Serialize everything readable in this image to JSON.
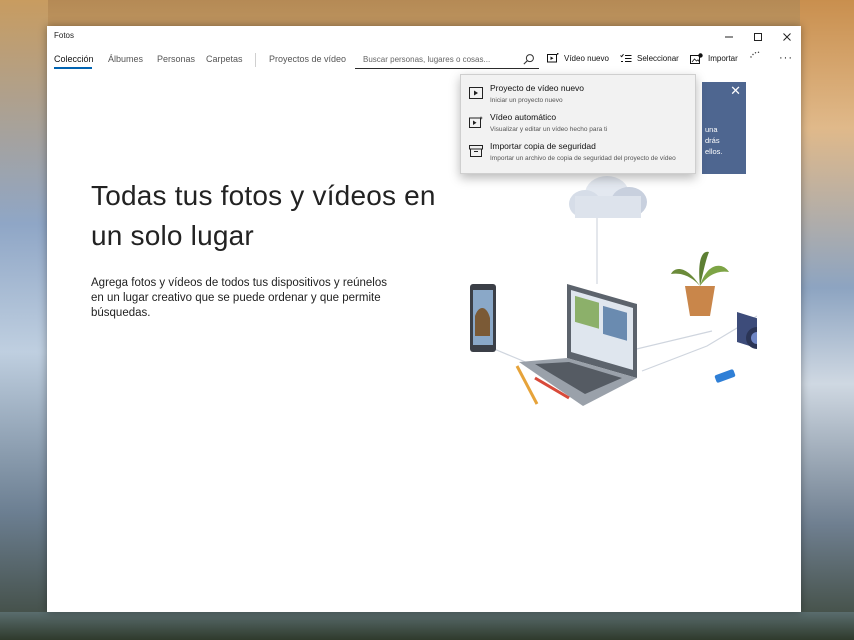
{
  "window": {
    "title": "Fotos"
  },
  "nav": {
    "tabs": [
      {
        "label": "Colección",
        "active": true
      },
      {
        "label": "Álbumes"
      },
      {
        "label": "Personas"
      },
      {
        "label": "Carpetas"
      },
      {
        "label": "Proyectos de vídeo"
      }
    ]
  },
  "search": {
    "placeholder": "Buscar personas, lugares o cosas...",
    "value": ""
  },
  "toolbar": {
    "new_video_label": "Vídeo nuevo",
    "select_label": "Seleccionar",
    "import_label": "Importar",
    "more_label": "···"
  },
  "main": {
    "heading": "Todas tus fotos y vídeos en un solo lugar",
    "description": "Agrega fotos y vídeos de todos tus dispositivos y reúnelos en un lugar creativo que se puede ordenar y que permite búsquedas."
  },
  "dropdown": {
    "items": [
      {
        "title": "Proyecto de vídeo nuevo",
        "subtitle": "Iniciar un proyecto nuevo",
        "icon": "video-project-icon"
      },
      {
        "title": "Vídeo automático",
        "subtitle": "Visualizar y editar un vídeo hecho para ti",
        "icon": "auto-video-icon"
      },
      {
        "title": "Importar copia de seguridad",
        "subtitle": "Importar un archivo de copia de seguridad del proyecto de vídeo",
        "icon": "import-backup-icon"
      }
    ]
  },
  "teaching_tip": {
    "partial_text": "una\ndrás\nellos."
  },
  "colors": {
    "accent": "#0063b1",
    "tip_background": "#4e6690",
    "menu_background": "#f2f2f2"
  }
}
